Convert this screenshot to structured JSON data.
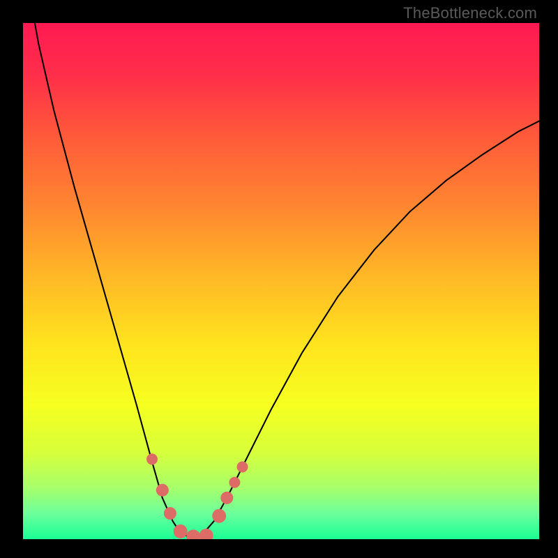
{
  "watermark": "TheBottleneck.com",
  "gradient_stops": [
    {
      "offset": 0.0,
      "color": "#ff1a52"
    },
    {
      "offset": 0.1,
      "color": "#ff2e4a"
    },
    {
      "offset": 0.22,
      "color": "#ff5a3a"
    },
    {
      "offset": 0.35,
      "color": "#ff8430"
    },
    {
      "offset": 0.48,
      "color": "#ffb427"
    },
    {
      "offset": 0.62,
      "color": "#ffe31e"
    },
    {
      "offset": 0.74,
      "color": "#f6ff20"
    },
    {
      "offset": 0.83,
      "color": "#d8ff3a"
    },
    {
      "offset": 0.9,
      "color": "#a8ff6a"
    },
    {
      "offset": 0.95,
      "color": "#6cff9c"
    },
    {
      "offset": 1.0,
      "color": "#1aff94"
    }
  ],
  "chart_data": {
    "type": "line",
    "title": "",
    "xlabel": "",
    "ylabel": "",
    "xlim": [
      0,
      100
    ],
    "ylim": [
      0,
      100
    ],
    "grid": false,
    "legend": false,
    "series": [
      {
        "name": "bottleneck-curve",
        "stroke": "#000000",
        "stroke_width": 2.0,
        "x": [
          0.5,
          3,
          6,
          10,
          14,
          18,
          22,
          25,
          27,
          29,
          30.5,
          32,
          33.5,
          35,
          37,
          39.5,
          43,
          48,
          54,
          61,
          68,
          75,
          82,
          89,
          96,
          100
        ],
        "values": [
          110,
          96,
          83,
          68,
          54,
          40,
          26,
          15,
          8,
          3.5,
          1.2,
          0.5,
          0.5,
          1.2,
          3.5,
          8,
          15,
          25,
          36,
          47,
          56,
          63.5,
          69.5,
          74.5,
          79,
          81
        ]
      }
    ],
    "markers": [
      {
        "x": 25.0,
        "y": 15.5,
        "r": 8,
        "color": "#de6c66"
      },
      {
        "x": 27.0,
        "y": 9.5,
        "r": 9,
        "color": "#de6c66"
      },
      {
        "x": 28.5,
        "y": 5.0,
        "r": 9,
        "color": "#de6c66"
      },
      {
        "x": 30.5,
        "y": 1.5,
        "r": 10,
        "color": "#de6c66"
      },
      {
        "x": 33.0,
        "y": 0.5,
        "r": 10,
        "color": "#de6c66"
      },
      {
        "x": 35.5,
        "y": 0.7,
        "r": 10,
        "color": "#de6c66"
      },
      {
        "x": 38.0,
        "y": 4.5,
        "r": 10,
        "color": "#de6c66"
      },
      {
        "x": 39.5,
        "y": 8.0,
        "r": 9,
        "color": "#de6c66"
      },
      {
        "x": 41.0,
        "y": 11.0,
        "r": 8,
        "color": "#de6c66"
      },
      {
        "x": 42.5,
        "y": 14.0,
        "r": 8,
        "color": "#de6c66"
      }
    ]
  }
}
